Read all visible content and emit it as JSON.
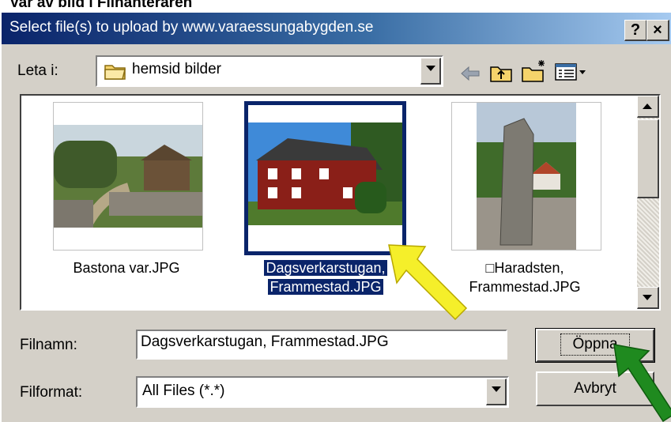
{
  "page": {
    "caption": "Var av bild i Filhanteraren"
  },
  "dialog": {
    "title": "Select file(s) to upload by www.varaessungabygden.se",
    "help_glyph": "?",
    "close_glyph": "×",
    "look_in_label": "Leta i:",
    "look_in_value": "hemsid bilder",
    "files": [
      {
        "name_line1": "Bastona var.JPG",
        "name_line2": "",
        "selected": false
      },
      {
        "name_line1": "Dagsverkarstugan,",
        "name_line2": "Frammestad.JPG",
        "selected": true
      },
      {
        "name_line1": "□Haradsten,",
        "name_line2": "Frammestad.JPG",
        "selected": false
      }
    ],
    "filename_label": "Filnamn:",
    "filename_value": "Dagsverkarstugan, Frammestad.JPG",
    "filetype_label": "Filformat:",
    "filetype_value": "All Files (*.*)",
    "open_button": "Öppna",
    "cancel_button": "Avbryt"
  },
  "colors": {
    "title_start": "#0a246a",
    "title_end": "#a6caf0",
    "dialog_face": "#d4d0c8",
    "selection": "#0a246a",
    "yellow_arrow": "#f5ef2a",
    "green_arrow": "#1f8a1f"
  },
  "icons": [
    "folder-icon",
    "back-arrow-icon",
    "up-folder-icon",
    "new-folder-icon",
    "view-menu-icon",
    "dropdown-arrow-icon",
    "scroll-up-icon",
    "scroll-down-icon"
  ]
}
